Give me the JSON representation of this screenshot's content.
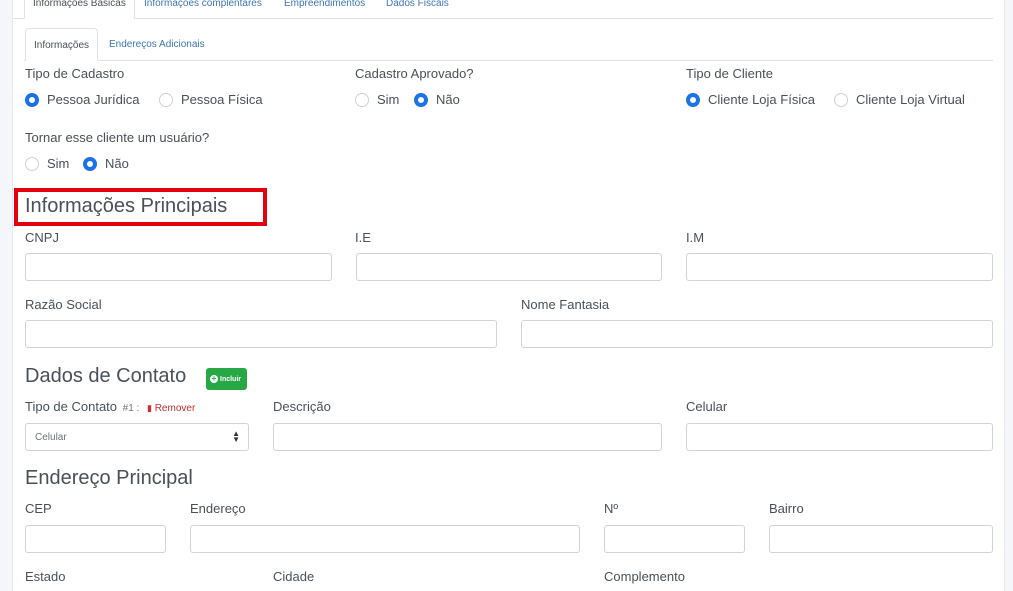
{
  "tabs": {
    "top": [
      "Informações Básicas",
      "Informações complentares",
      "Empreendimentos",
      "Dados Fiscais"
    ],
    "sub": [
      "Informações",
      "Endereços Adicionais"
    ]
  },
  "tipo_cadastro": {
    "label": "Tipo de Cadastro",
    "options": [
      "Pessoa Jurídica",
      "Pessoa Física"
    ],
    "selected": "Pessoa Jurídica"
  },
  "cadastro_aprovado": {
    "label": "Cadastro Aprovado?",
    "options": [
      "Sim",
      "Não"
    ],
    "selected": "Não"
  },
  "tipo_cliente": {
    "label": "Tipo de Cliente",
    "options": [
      "Cliente Loja Física",
      "Cliente Loja Virtual"
    ],
    "selected": "Cliente Loja Física"
  },
  "tornar_usuario": {
    "label": "Tornar esse cliente um usuário?",
    "options": [
      "Sim",
      "Não"
    ],
    "selected": "Não"
  },
  "info_principais": {
    "title": "Informações Principais",
    "cnpj": "CNPJ",
    "ie": "I.E",
    "im": "I.M",
    "razao_social": "Razão Social",
    "nome_fantasia": "Nome Fantasia"
  },
  "contato": {
    "title": "Dados de Contato",
    "add_label": "Incluir",
    "tipo_label": "Tipo de Contato",
    "index": "#1 :",
    "remove_label": "Remover",
    "tipo_value": "Celular",
    "descricao": "Descrição",
    "celular": "Celular"
  },
  "endereco": {
    "title": "Endereço Principal",
    "cep": "CEP",
    "endereco": "Endereço",
    "numero": "Nº",
    "bairro": "Bairro",
    "estado": "Estado",
    "cidade": "Cidade",
    "complemento": "Complemento"
  },
  "colors": {
    "accent": "#1a73e8",
    "highlight": "#e3000f",
    "success": "#28a745",
    "danger": "#c9302c"
  },
  "icons": [
    "plus-circle-icon",
    "trash-icon",
    "select-caret-icon"
  ]
}
